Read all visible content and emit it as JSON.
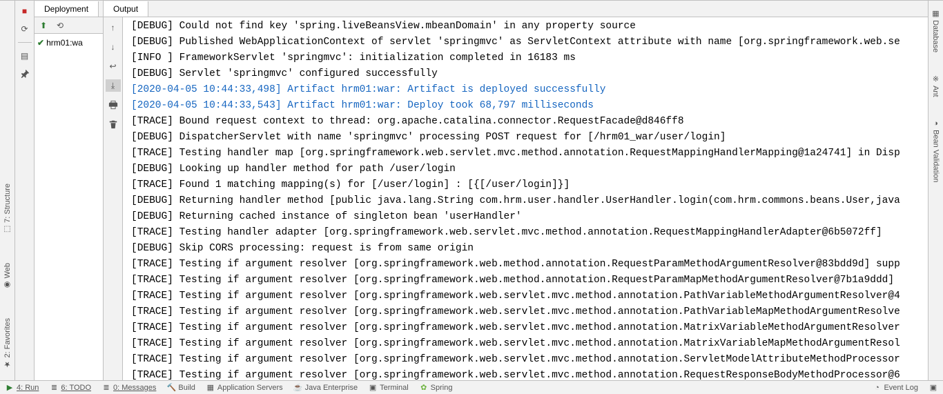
{
  "left_side": {
    "structure": "7: Structure",
    "web": "Web",
    "favorites": "2: Favorites"
  },
  "tabs": {
    "deployment": "Deployment",
    "output": "Output"
  },
  "tree": {
    "item_label": "hrm01:wa"
  },
  "console": {
    "lines": [
      {
        "t": "[DEBUG] Could not find key 'spring.liveBeansView.mbeanDomain' in any property source",
        "c": ""
      },
      {
        "t": "[DEBUG] Published WebApplicationContext of servlet 'springmvc' as ServletContext attribute with name [org.springframework.web.se",
        "c": ""
      },
      {
        "t": "[INFO ] FrameworkServlet 'springmvc': initialization completed in 16183 ms",
        "c": ""
      },
      {
        "t": "[DEBUG] Servlet 'springmvc' configured successfully",
        "c": ""
      },
      {
        "t": "[2020-04-05 10:44:33,498] Artifact hrm01:war: Artifact is deployed successfully",
        "c": "highlight"
      },
      {
        "t": "[2020-04-05 10:44:33,543] Artifact hrm01:war: Deploy took 68,797 milliseconds",
        "c": "highlight"
      },
      {
        "t": "[TRACE] Bound request context to thread: org.apache.catalina.connector.RequestFacade@d846ff8",
        "c": ""
      },
      {
        "t": "[DEBUG] DispatcherServlet with name 'springmvc' processing POST request for [/hrm01_war/user/login]",
        "c": ""
      },
      {
        "t": "[TRACE] Testing handler map [org.springframework.web.servlet.mvc.method.annotation.RequestMappingHandlerMapping@1a24741] in Disp",
        "c": ""
      },
      {
        "t": "[DEBUG] Looking up handler method for path /user/login",
        "c": ""
      },
      {
        "t": "[TRACE] Found 1 matching mapping(s) for [/user/login] : [{[/user/login]}]",
        "c": ""
      },
      {
        "t": "[DEBUG] Returning handler method [public java.lang.String com.hrm.user.handler.UserHandler.login(com.hrm.commons.beans.User,java",
        "c": ""
      },
      {
        "t": "[DEBUG] Returning cached instance of singleton bean 'userHandler'",
        "c": ""
      },
      {
        "t": "[TRACE] Testing handler adapter [org.springframework.web.servlet.mvc.method.annotation.RequestMappingHandlerAdapter@6b5072ff]",
        "c": ""
      },
      {
        "t": "[DEBUG] Skip CORS processing: request is from same origin",
        "c": ""
      },
      {
        "t": "[TRACE] Testing if argument resolver [org.springframework.web.method.annotation.RequestParamMethodArgumentResolver@83bdd9d] supp",
        "c": ""
      },
      {
        "t": "[TRACE] Testing if argument resolver [org.springframework.web.method.annotation.RequestParamMapMethodArgumentResolver@7b1a9ddd] ",
        "c": ""
      },
      {
        "t": "[TRACE] Testing if argument resolver [org.springframework.web.servlet.mvc.method.annotation.PathVariableMethodArgumentResolver@4",
        "c": ""
      },
      {
        "t": "[TRACE] Testing if argument resolver [org.springframework.web.servlet.mvc.method.annotation.PathVariableMapMethodArgumentResolve",
        "c": ""
      },
      {
        "t": "[TRACE] Testing if argument resolver [org.springframework.web.servlet.mvc.method.annotation.MatrixVariableMethodArgumentResolver",
        "c": ""
      },
      {
        "t": "[TRACE] Testing if argument resolver [org.springframework.web.servlet.mvc.method.annotation.MatrixVariableMapMethodArgumentResol",
        "c": ""
      },
      {
        "t": "[TRACE] Testing if argument resolver [org.springframework.web.servlet.mvc.method.annotation.ServletModelAttributeMethodProcessor",
        "c": ""
      },
      {
        "t": "[TRACE] Testing if argument resolver [org.springframework.web.servlet.mvc.method.annotation.RequestResponseBodyMethodProcessor@6",
        "c": ""
      }
    ]
  },
  "right_side": {
    "database": "Database",
    "ant": "Ant",
    "bean": "Bean Validation"
  },
  "bottom": {
    "run": "4: Run",
    "todo": "6: TODO",
    "messages": "0: Messages",
    "build": "Build",
    "appservers": "Application Servers",
    "javaee": "Java Enterprise",
    "terminal": "Terminal",
    "spring": "Spring",
    "eventlog": "Event Log"
  }
}
